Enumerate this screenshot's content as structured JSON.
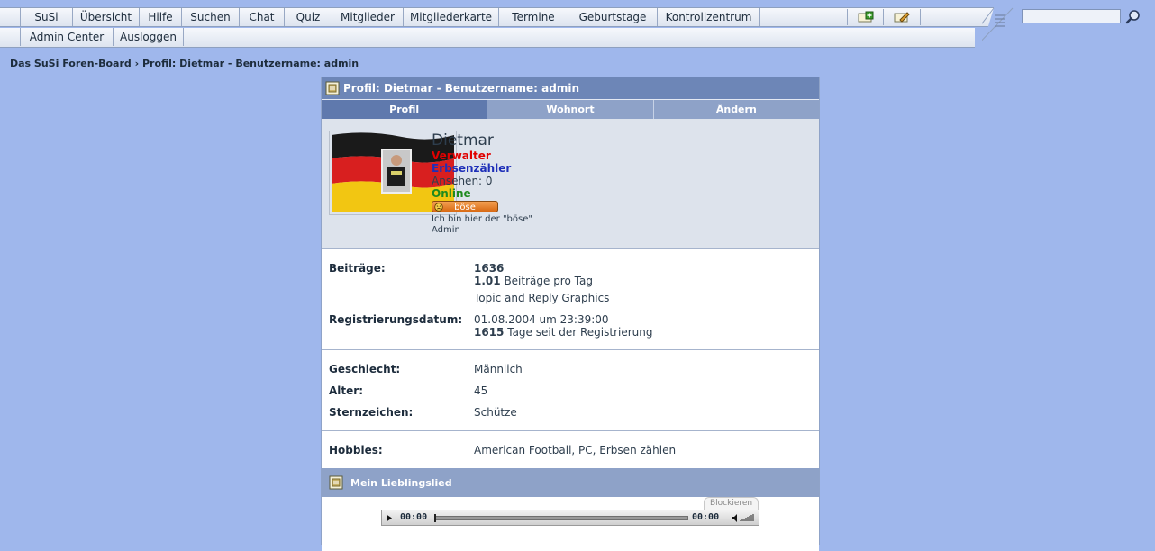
{
  "nav": {
    "row1": [
      "SuSi",
      "Übersicht",
      "Hilfe",
      "Suchen",
      "Chat",
      "Quiz",
      "Mitglieder",
      "Mitgliederkarte",
      "Termine",
      "Geburtstage",
      "Kontrollzentrum"
    ],
    "row2": [
      "Admin Center",
      "Ausloggen"
    ],
    "icons": [
      "add-icon",
      "edit-icon",
      "list-icon",
      "search-icon"
    ]
  },
  "breadcrumb": "Das SuSi Foren-Board › Profil: Dietmar - Benutzername: admin",
  "panel": {
    "title": "Profil: Dietmar - Benutzername: admin",
    "tabs": [
      {
        "label": "Profil",
        "active": true
      },
      {
        "label": "Wohnort",
        "active": false
      },
      {
        "label": "Ändern",
        "active": false
      }
    ]
  },
  "user": {
    "name": "Dietmar",
    "rank1": "Verwalter",
    "rank2": "Erbsenzähler",
    "ansehen": "Ansehen: 0",
    "status": "Online",
    "mood": "böse",
    "signature_line1": "Ich bin hier der \"böse\"",
    "signature_line2": "Admin",
    "colors": {
      "rank1": "#e00000",
      "rank2": "#1e2fb8",
      "online": "#1e8a1e"
    }
  },
  "stats": {
    "posts_label": "Beiträge:",
    "posts_count": "1636",
    "posts_per_day": "1.01",
    "posts_per_day_text": "Beiträge pro Tag",
    "topic_reply": "Topic and Reply Graphics",
    "reg_label": "Registrierungsdatum:",
    "reg_date": "01.08.2004 um 23:39:00",
    "reg_days": "1615",
    "reg_days_text": "Tage seit der Registrierung"
  },
  "personal": {
    "gender_label": "Geschlecht:",
    "gender": "Männlich",
    "age_label": "Alter:",
    "age": "45",
    "zodiac_label": "Sternzeichen:",
    "zodiac": "Schütze"
  },
  "hobbies": {
    "label": "Hobbies:",
    "value": "American Football, PC, Erbsen zählen"
  },
  "song": {
    "title": "Mein Lieblingslied",
    "block_label": "Blockieren",
    "time_elapsed": "00:00",
    "time_total": "00:00"
  }
}
